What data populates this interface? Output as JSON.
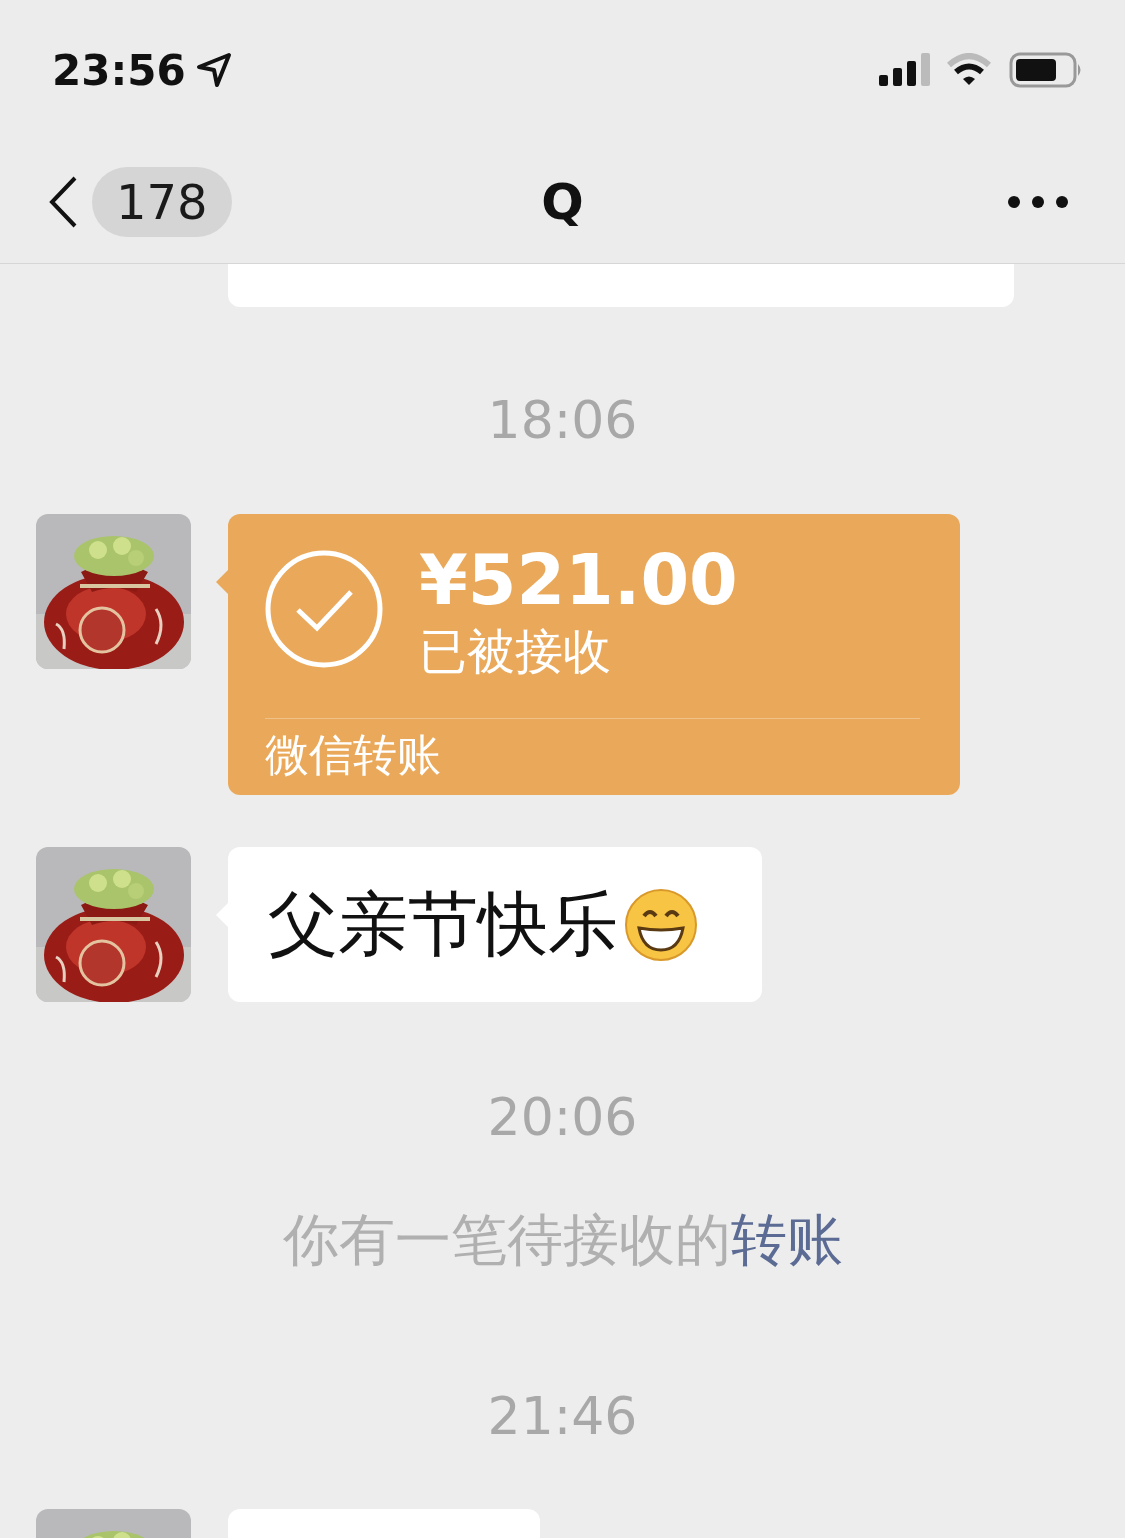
{
  "status_bar": {
    "time": "23:56"
  },
  "nav": {
    "unread": "178",
    "title": "Q"
  },
  "messages": [
    {
      "kind": "cut_top"
    },
    {
      "kind": "time",
      "text": "18:06"
    },
    {
      "kind": "transfer",
      "amount": "¥521.00",
      "status": "已被接收",
      "footer": "微信转账",
      "received": true
    },
    {
      "kind": "text",
      "text": "父亲节快乐",
      "emoji": true
    },
    {
      "kind": "time",
      "text": "20:06"
    },
    {
      "kind": "system",
      "text": "你有一笔待接收的",
      "link": "转账"
    },
    {
      "kind": "time",
      "text": "21:46"
    },
    {
      "kind": "cut_bottom"
    }
  ]
}
